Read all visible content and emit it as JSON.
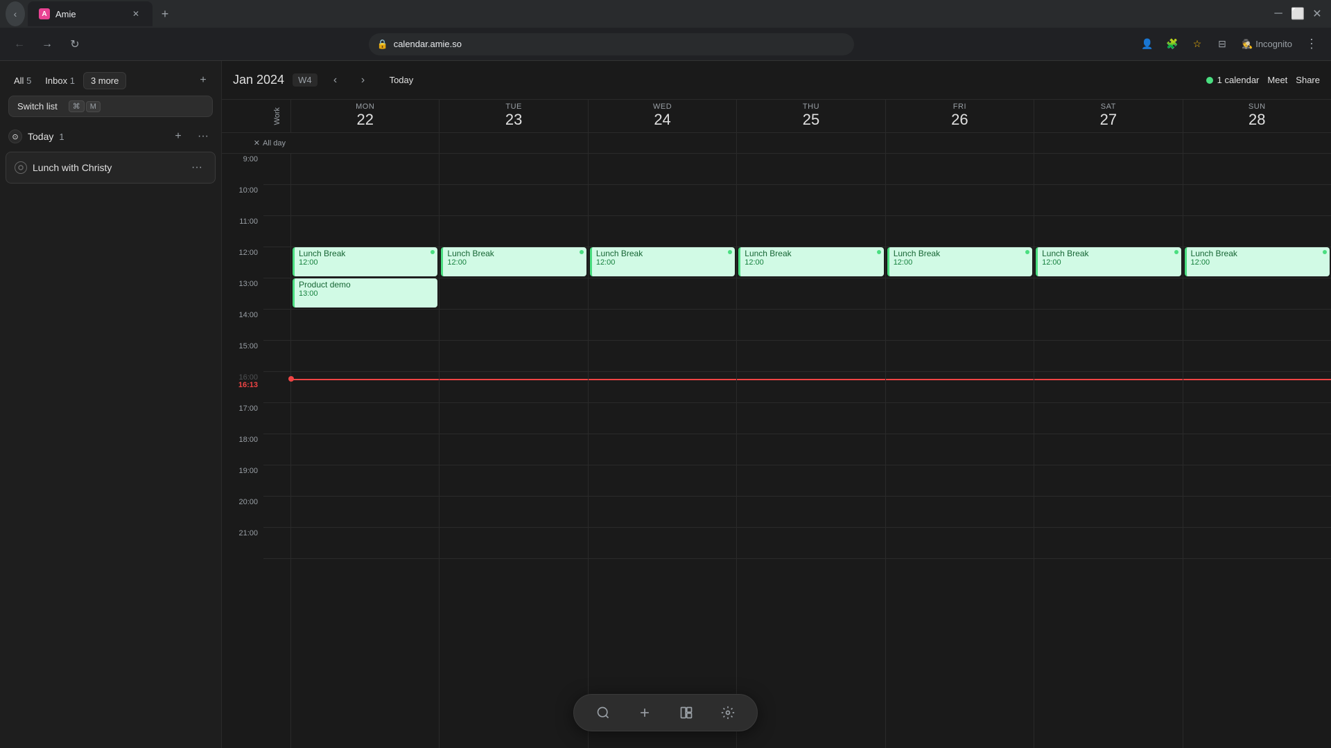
{
  "browser": {
    "url": "calendar.amie.so",
    "tab_title": "Amie",
    "tab_favicon": "A",
    "incognito_label": "Incognito"
  },
  "sidebar": {
    "tabs": [
      {
        "label": "All",
        "count": "5",
        "active": false
      },
      {
        "label": "Inbox",
        "count": "1",
        "active": false
      }
    ],
    "more_label": "3 more",
    "add_icon": "+",
    "switch_list_label": "Switch list",
    "shortcut_key1": "⌘",
    "shortcut_key2": "M",
    "today_section": {
      "title": "Today",
      "count": "1",
      "tasks": [
        {
          "label": "Lunch with Christy"
        }
      ]
    }
  },
  "calendar": {
    "title": "Jan 2024",
    "week_badge": "W4",
    "today_btn": "Today",
    "calendar_count": "1 calendar",
    "meet_btn": "Meet",
    "share_btn": "Share",
    "work_label": "Work",
    "allday_label": "All day",
    "current_time": "16:13",
    "days": [
      {
        "name": "Mon",
        "num": "22"
      },
      {
        "name": "Tue",
        "num": "23"
      },
      {
        "name": "Wed",
        "num": "24"
      },
      {
        "name": "Thu",
        "num": "25"
      },
      {
        "name": "Fri",
        "num": "26"
      },
      {
        "name": "Sat",
        "num": "27"
      },
      {
        "name": "Sun",
        "num": "28"
      }
    ],
    "hours": [
      "9:00",
      "10:00",
      "11:00",
      "12:00",
      "13:00",
      "14:00",
      "15:00",
      "16:00",
      "17:00",
      "18:00",
      "19:00",
      "20:00",
      "21:00"
    ],
    "events": {
      "lunch_break_label": "Lunch Break",
      "lunch_break_time": "12:00",
      "product_demo_label": "Product demo",
      "product_demo_time": "13:00"
    }
  },
  "bottom_toolbar": {
    "search_icon": "🔍",
    "add_icon": "+",
    "layout_icon": "⊞",
    "settings_icon": "⚙"
  }
}
